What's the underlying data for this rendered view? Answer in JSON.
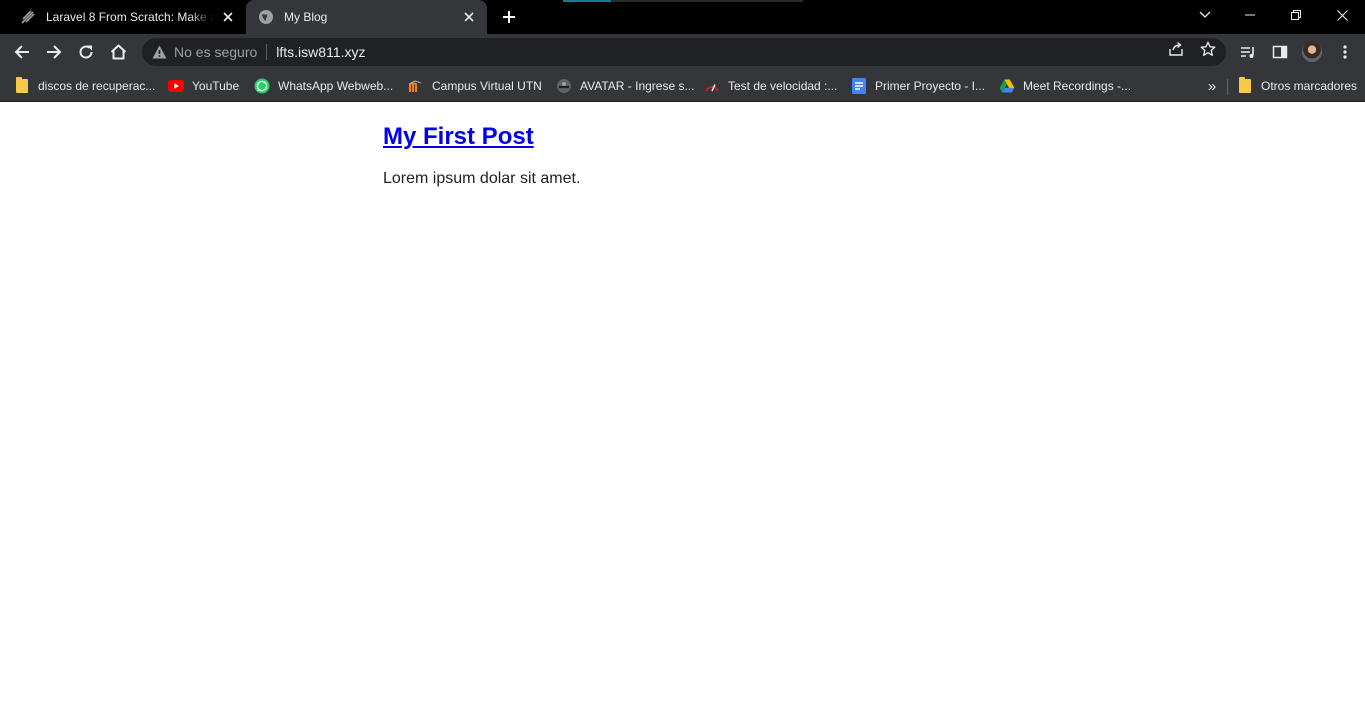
{
  "browser": {
    "tabs": [
      {
        "title": "Laravel 8 From Scratch: Make a P",
        "favicon": "laracasts-icon",
        "active": false
      },
      {
        "title": "My Blog",
        "favicon": "globe-icon",
        "active": true
      }
    ],
    "address_bar": {
      "security_label": "No es seguro",
      "url": "lfts.isw811.xyz"
    },
    "bookmarks": [
      {
        "label": "discos de recuperac...",
        "icon": "folder-icon"
      },
      {
        "label": "YouTube",
        "icon": "youtube-icon"
      },
      {
        "label": "WhatsApp Webweb...",
        "icon": "whatsapp-icon"
      },
      {
        "label": "Campus Virtual UTN",
        "icon": "moodle-icon"
      },
      {
        "label": "AVATAR - Ingrese s...",
        "icon": "avatar-site-icon"
      },
      {
        "label": "Test de velocidad :...",
        "icon": "speedometer-icon"
      },
      {
        "label": "Primer Proyecto - I...",
        "icon": "google-docs-icon"
      },
      {
        "label": "Meet Recordings -...",
        "icon": "google-drive-icon"
      }
    ],
    "bookmarks_overflow": "»",
    "other_bookmarks": "Otros marcadores"
  },
  "page": {
    "post": {
      "title": "My First Post",
      "body": "Lorem ipsum dolar sit amet."
    }
  },
  "colors": {
    "tabstrip_bg": "#000000",
    "toolbar_bg": "#35363a",
    "omnibox_bg": "#202124",
    "link": "#0000ee"
  }
}
